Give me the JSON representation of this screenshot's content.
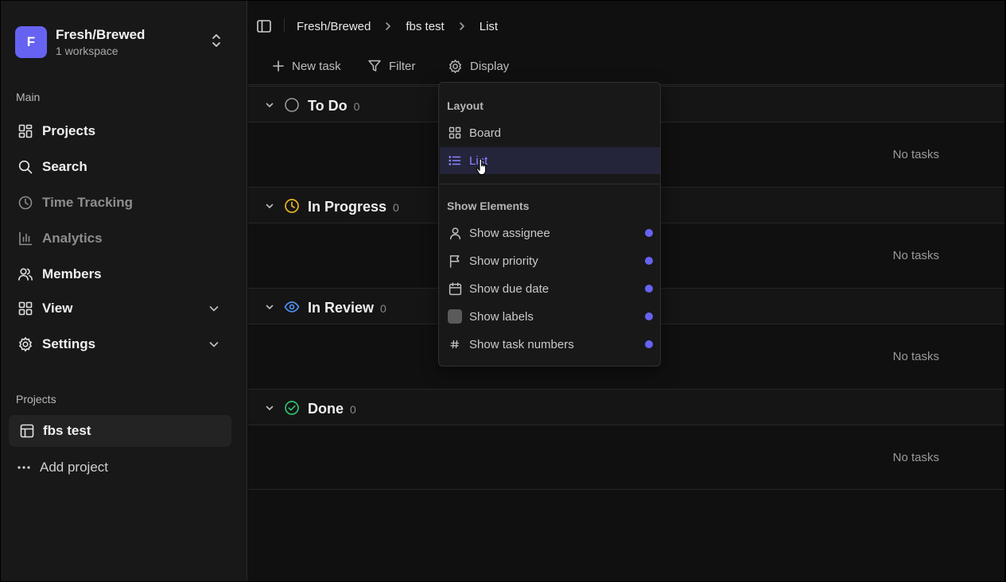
{
  "workspace": {
    "initial": "F",
    "name": "Fresh/Brewed",
    "subtitle": "1 workspace"
  },
  "sidebar": {
    "main_label": "Main",
    "items": [
      {
        "label": "Projects",
        "icon": "grid-icon"
      },
      {
        "label": "Search",
        "icon": "search-icon"
      },
      {
        "label": "Time Tracking",
        "icon": "clock-icon"
      },
      {
        "label": "Analytics",
        "icon": "bar-chart-icon"
      },
      {
        "label": "Members",
        "icon": "users-icon"
      },
      {
        "label": "View",
        "icon": "grid-icon"
      },
      {
        "label": "Settings",
        "icon": "gear-icon"
      }
    ],
    "projects_label": "Projects",
    "projects": [
      {
        "label": "fbs test"
      }
    ],
    "add_project": "Add project"
  },
  "breadcrumb": [
    "Fresh/Brewed",
    "fbs test",
    "List"
  ],
  "toolbar": {
    "new_task": "New task",
    "filter": "Filter",
    "display": "Display"
  },
  "groups": [
    {
      "title": "To Do",
      "count": "0",
      "empty": "No tasks",
      "color": "#9a9a9a"
    },
    {
      "title": "In Progress",
      "count": "0",
      "empty": "No tasks",
      "color": "#e8b420"
    },
    {
      "title": "In Review",
      "count": "0",
      "empty": "No tasks",
      "color": "#4a8ff0"
    },
    {
      "title": "Done",
      "count": "0",
      "empty": "No tasks",
      "color": "#2fbf71"
    }
  ],
  "display_menu": {
    "layout_label": "Layout",
    "layouts": [
      {
        "label": "Board"
      },
      {
        "label": "List"
      }
    ],
    "elements_label": "Show Elements",
    "elements": [
      {
        "label": "Show assignee"
      },
      {
        "label": "Show priority"
      },
      {
        "label": "Show due date"
      },
      {
        "label": "Show labels"
      },
      {
        "label": "Show task numbers"
      }
    ]
  },
  "colors": {
    "accent": "#6663f2"
  }
}
